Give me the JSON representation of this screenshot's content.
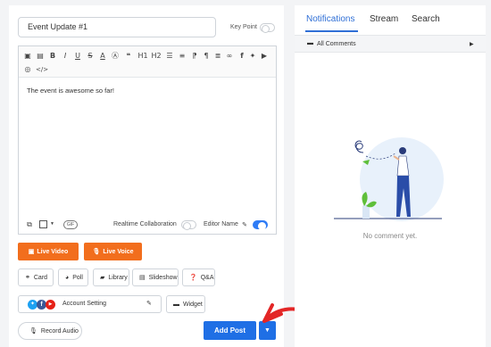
{
  "post": {
    "title_value": "Event Update #1",
    "key_point_label": "Key Point",
    "body_text": "The event is awesome so far!"
  },
  "toolbar": {
    "icons": [
      "image-icon",
      "gallery-icon",
      "bold-icon",
      "italic-icon",
      "underline-icon",
      "strikethrough-icon",
      "text-color-icon",
      "highlight-icon",
      "quote-icon",
      "heading1-icon",
      "heading2-icon",
      "ordered-list-icon",
      "unordered-list-icon",
      "rtl-icon",
      "pilcrow-icon",
      "align-icon",
      "link-icon",
      "facebook-icon",
      "twitter-icon",
      "youtube-icon",
      "instagram-icon",
      "code-icon"
    ]
  },
  "editor_footer": {
    "gif_label": "GIF",
    "realtime_label": "Realtime Collaboration",
    "editor_name_label": "Editor Name"
  },
  "actions": {
    "live_video": "Live Video",
    "live_voice": "Live Voice",
    "card": "Card",
    "poll": "Poll",
    "library": "Library",
    "slideshow": "Slideshow",
    "qa": "Q&A",
    "account_setting": "Account Setting",
    "widget": "Widget",
    "record_audio": "Record Audio",
    "add_post": "Add Post"
  },
  "right_panel": {
    "tabs": [
      "Notifications",
      "Stream",
      "Search"
    ],
    "filter_label": "All Comments",
    "empty_text": "No comment yet."
  },
  "colors": {
    "accent_blue": "#1f6fe5",
    "orange": "#f26e1d",
    "annotation_arrow": "#e32626"
  }
}
